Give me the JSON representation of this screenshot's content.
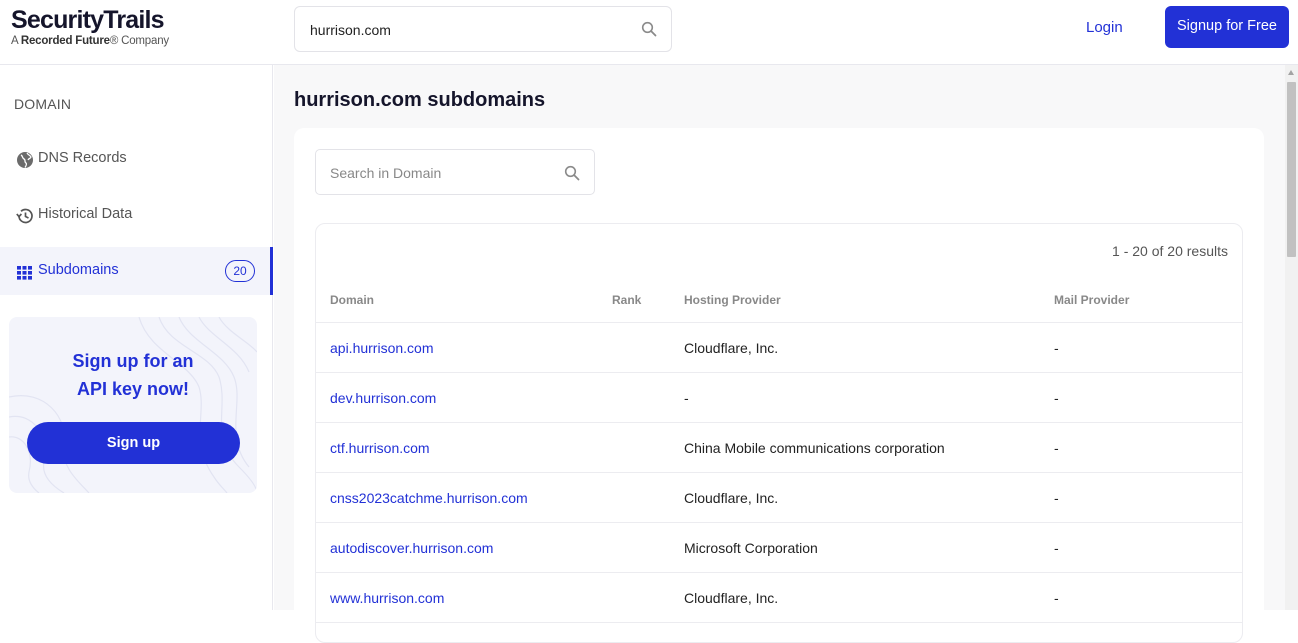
{
  "header": {
    "logo_main": "SecurityTrails",
    "logo_sub_prefix": "A ",
    "logo_sub_brand": "Recorded Future",
    "logo_sub_suffix": "® Company",
    "search_value": "hurrison.com",
    "login_label": "Login",
    "signup_label": "Signup for Free"
  },
  "sidebar": {
    "section_title": "DOMAIN",
    "items": [
      {
        "label": "DNS Records",
        "icon": "globe-icon"
      },
      {
        "label": "Historical Data",
        "icon": "history-icon"
      },
      {
        "label": "Subdomains",
        "icon": "grid-icon",
        "badge": "20",
        "active": true
      }
    ],
    "promo": {
      "title_line1": "Sign up for an",
      "title_line2": "API key now!",
      "button_label": "Sign up"
    }
  },
  "main": {
    "title": "hurrison.com subdomains",
    "search_placeholder": "Search in Domain",
    "results_text": "1 - 20 of 20 results",
    "columns": [
      "Domain",
      "Rank",
      "Hosting Provider",
      "Mail Provider"
    ],
    "rows": [
      {
        "domain": "api.hurrison.com",
        "rank": "",
        "hosting": "Cloudflare, Inc.",
        "mail": "-"
      },
      {
        "domain": "dev.hurrison.com",
        "rank": "",
        "hosting": "-",
        "mail": "-"
      },
      {
        "domain": "ctf.hurrison.com",
        "rank": "",
        "hosting": "China Mobile communications corporation",
        "mail": "-"
      },
      {
        "domain": "cnss2023catchme.hurrison.com",
        "rank": "",
        "hosting": "Cloudflare, Inc.",
        "mail": "-"
      },
      {
        "domain": "autodiscover.hurrison.com",
        "rank": "",
        "hosting": "Microsoft Corporation",
        "mail": "-"
      },
      {
        "domain": "www.hurrison.com",
        "rank": "",
        "hosting": "Cloudflare, Inc.",
        "mail": "-"
      }
    ]
  },
  "colors": {
    "accent": "#2231d6",
    "active_bg": "#f3f4fb",
    "page_bg": "#f8f8f9"
  }
}
